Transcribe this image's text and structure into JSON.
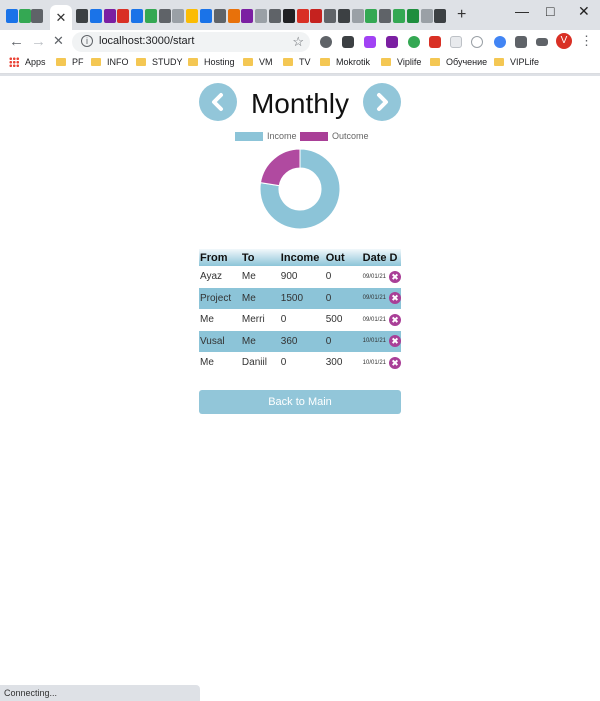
{
  "browser": {
    "url": "localhost:3000/start",
    "tab_close": "✕",
    "new_tab": "+",
    "profile_initial": "V",
    "bookmarks": [
      "Apps",
      "PF",
      "INFO",
      "STUDY",
      "Hosting",
      "VM",
      "TV",
      "Mokrotik",
      "Viplife",
      "Обучение",
      "VIPLife"
    ],
    "status": "Connecting..."
  },
  "page": {
    "title": "Monthly",
    "legend": [
      {
        "label": "Income",
        "color": "#8cc4d8"
      },
      {
        "label": "Outcome",
        "color": "#a93f97"
      }
    ],
    "chart_data": {
      "type": "pie",
      "labels": [
        "Income",
        "Outcome"
      ],
      "values": [
        2760,
        800
      ],
      "colors": [
        "#8cc4d8",
        "#b04aa0"
      ]
    },
    "table": {
      "headers": [
        "From",
        "To",
        "Income",
        "Out",
        "Date D"
      ],
      "rows": [
        {
          "from": "Ayaz",
          "to": "Me",
          "income": "900",
          "out": "0",
          "date": "09/01/21"
        },
        {
          "from": "Project",
          "to": "Me",
          "income": "1500",
          "out": "0",
          "date": "09/01/21"
        },
        {
          "from": "Me",
          "to": "Merri",
          "income": "0",
          "out": "500",
          "date": "09/01/21"
        },
        {
          "from": "Vusal",
          "to": "Me",
          "income": "360",
          "out": "0",
          "date": "10/01/21"
        },
        {
          "from": "Me",
          "to": "Daniil",
          "income": "0",
          "out": "300",
          "date": "10/01/21"
        }
      ],
      "delete_glyph": "✖"
    },
    "back_button": "Back to Main"
  }
}
